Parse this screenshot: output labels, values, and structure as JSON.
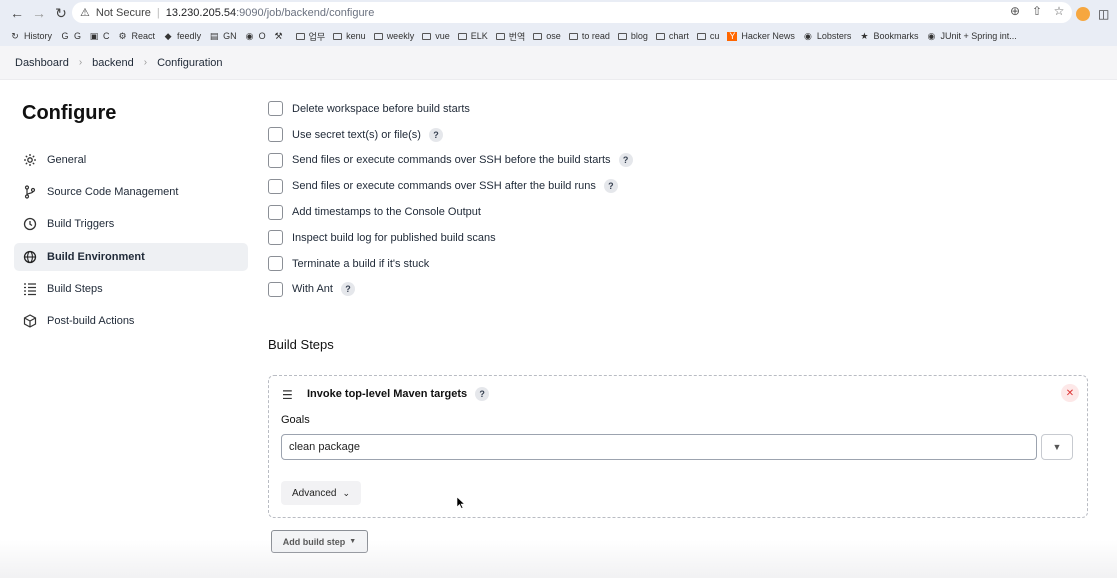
{
  "browser": {
    "security_label": "Not Secure",
    "url_host": "13.230.205.54",
    "url_path": ":9090/job/backend/configure",
    "bookmarks": [
      {
        "icon": "history-icon",
        "label": "History"
      },
      {
        "icon": "google-translate-icon",
        "label": "G"
      },
      {
        "icon": "c-icon",
        "label": "C"
      },
      {
        "icon": "react-icon",
        "label": "React"
      },
      {
        "icon": "feedly-icon",
        "label": "feedly"
      },
      {
        "icon": "gn-icon",
        "label": "GN"
      },
      {
        "icon": "github-icon",
        "label": "O"
      },
      {
        "icon": "tools-icon",
        "label": ""
      },
      {
        "icon": "folder-icon",
        "label": "업무"
      },
      {
        "icon": "folder-icon",
        "label": "kenu"
      },
      {
        "icon": "folder-icon",
        "label": "weekly"
      },
      {
        "icon": "folder-icon",
        "label": "vue"
      },
      {
        "icon": "folder-icon",
        "label": "ELK"
      },
      {
        "icon": "folder-icon",
        "label": "번역"
      },
      {
        "icon": "folder-icon",
        "label": "ose"
      },
      {
        "icon": "folder-icon",
        "label": "to read"
      },
      {
        "icon": "folder-icon",
        "label": "blog"
      },
      {
        "icon": "folder-icon",
        "label": "chart"
      },
      {
        "icon": "folder-icon",
        "label": "cu"
      },
      {
        "icon": "hacker-news-icon",
        "label": "Hacker News"
      },
      {
        "icon": "globe-icon",
        "label": "Lobsters"
      },
      {
        "icon": "star-icon",
        "label": "Bookmarks"
      },
      {
        "icon": "globe-icon",
        "label": "JUnit + Spring int..."
      }
    ]
  },
  "breadcrumb": [
    "Dashboard",
    "backend",
    "Configuration"
  ],
  "page_title": "Configure",
  "sidebar": [
    {
      "label": "General",
      "icon": "gear-icon",
      "active": false
    },
    {
      "label": "Source Code Management",
      "icon": "branch-icon",
      "active": false
    },
    {
      "label": "Build Triggers",
      "icon": "clock-icon",
      "active": false
    },
    {
      "label": "Build Environment",
      "icon": "globe-icon",
      "active": true
    },
    {
      "label": "Build Steps",
      "icon": "list-icon",
      "active": false
    },
    {
      "label": "Post-build Actions",
      "icon": "cube-icon",
      "active": false
    }
  ],
  "build_environment_options": [
    {
      "label": "Delete workspace before build starts",
      "help": false
    },
    {
      "label": "Use secret text(s) or file(s)",
      "help": true
    },
    {
      "label": "Send files or execute commands over SSH before the build starts",
      "help": true
    },
    {
      "label": "Send files or execute commands over SSH after the build runs",
      "help": true
    },
    {
      "label": "Add timestamps to the Console Output",
      "help": false
    },
    {
      "label": "Inspect build log for published build scans",
      "help": false
    },
    {
      "label": "Terminate a build if it's stuck",
      "help": false
    },
    {
      "label": "With Ant",
      "help": true
    }
  ],
  "build_steps": {
    "title": "Build Steps",
    "step": {
      "title": "Invoke top-level Maven targets",
      "help": "?",
      "goals_label": "Goals",
      "goals_value": "clean package",
      "advanced_label": "Advanced"
    },
    "add_button": "Add build step"
  },
  "help_glyph": "?"
}
